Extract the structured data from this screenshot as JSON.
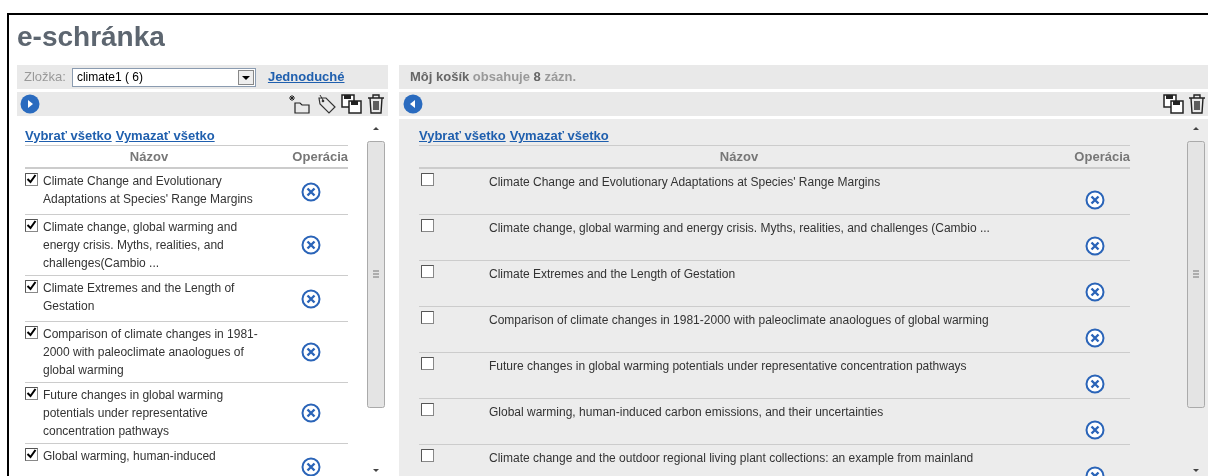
{
  "title": "e-schránka",
  "left": {
    "folder_label": "Zložka:",
    "folder_value": "climate1 ( 6)",
    "mode_link": "Jednoduché",
    "select_all": "Vybrať všetko",
    "clear_all": "Vymazať všetko",
    "columns": [
      "Názov",
      "Operácia"
    ],
    "rows": [
      {
        "title": "Climate Change and Evolutionary Adaptations at Species' Range Margins",
        "checked": true
      },
      {
        "title": "Climate change, global warming and energy crisis. Myths, realities, and challenges(Cambio ...",
        "checked": true
      },
      {
        "title": "Climate Extremes and the Length of Gestation",
        "checked": true
      },
      {
        "title": "Comparison of climate changes in 1981-2000 with paleoclimate anaologues of global warming",
        "checked": true
      },
      {
        "title": "Future changes in global warming potentials under representative concentration pathways",
        "checked": true
      },
      {
        "title": "Global warming, human-induced",
        "checked": true
      }
    ]
  },
  "right": {
    "basket": "**Môj košík** obsahuje **8** zázn.",
    "select_all": "Vybrať všetko",
    "clear_all": "Vymazať všetko",
    "columns": [
      "Názov",
      "Operácia"
    ],
    "rows": [
      {
        "title": "Climate Change and Evolutionary Adaptations at Species' Range Margins",
        "checked": false
      },
      {
        "title": "Climate change, global warming and energy crisis. Myths, realities, and challenges (Cambio ...",
        "checked": false
      },
      {
        "title": "Climate Extremes and the Length of Gestation",
        "checked": false
      },
      {
        "title": "Comparison of climate changes in 1981-2000 with paleoclimate anaologues of global warming",
        "checked": false
      },
      {
        "title": "Future changes in global warming potentials under representative concentration pathways",
        "checked": false
      },
      {
        "title": "Global warming, human-induced carbon emissions, and their uncertainties",
        "checked": false
      },
      {
        "title": "Climate change and the outdoor regional living plant collections: an example from mainland",
        "checked": false
      }
    ]
  }
}
